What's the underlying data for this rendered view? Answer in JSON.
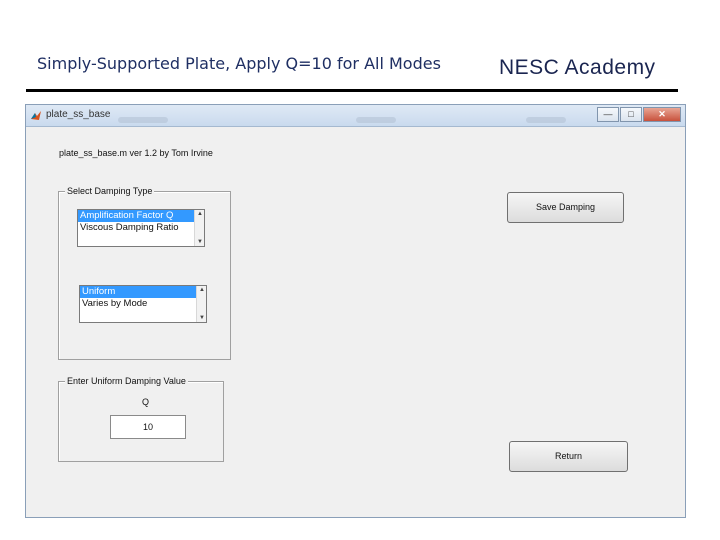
{
  "slide": {
    "title": "Simply-Supported Plate,  Apply Q=10  for All Modes",
    "brand": "NESC Academy"
  },
  "window": {
    "title": "plate_ss_base",
    "caption_buttons": {
      "minimize": "—",
      "maximize": "□",
      "close": "✕"
    }
  },
  "app": {
    "version_text": "plate_ss_base.m  ver 1.2  by Tom Irvine",
    "damping_group_label": "Select Damping Type",
    "damping_type_list": [
      "Amplification Factor Q",
      "Viscous Damping Ratio"
    ],
    "damping_type_selected": 0,
    "distribution_list": [
      "Uniform",
      "Varies by Mode"
    ],
    "distribution_selected": 0,
    "uniform_group_label": "Enter Uniform Damping Value",
    "q_label": "Q",
    "q_value": "10",
    "save_button": "Save Damping",
    "return_button": "Return"
  },
  "colors": {
    "selection": "#3399ff",
    "title_text": "#1f2f63",
    "window_bg": "#f0f0f0"
  },
  "icons": [
    "matlab-icon",
    "scroll-up-icon",
    "scroll-down-icon"
  ]
}
